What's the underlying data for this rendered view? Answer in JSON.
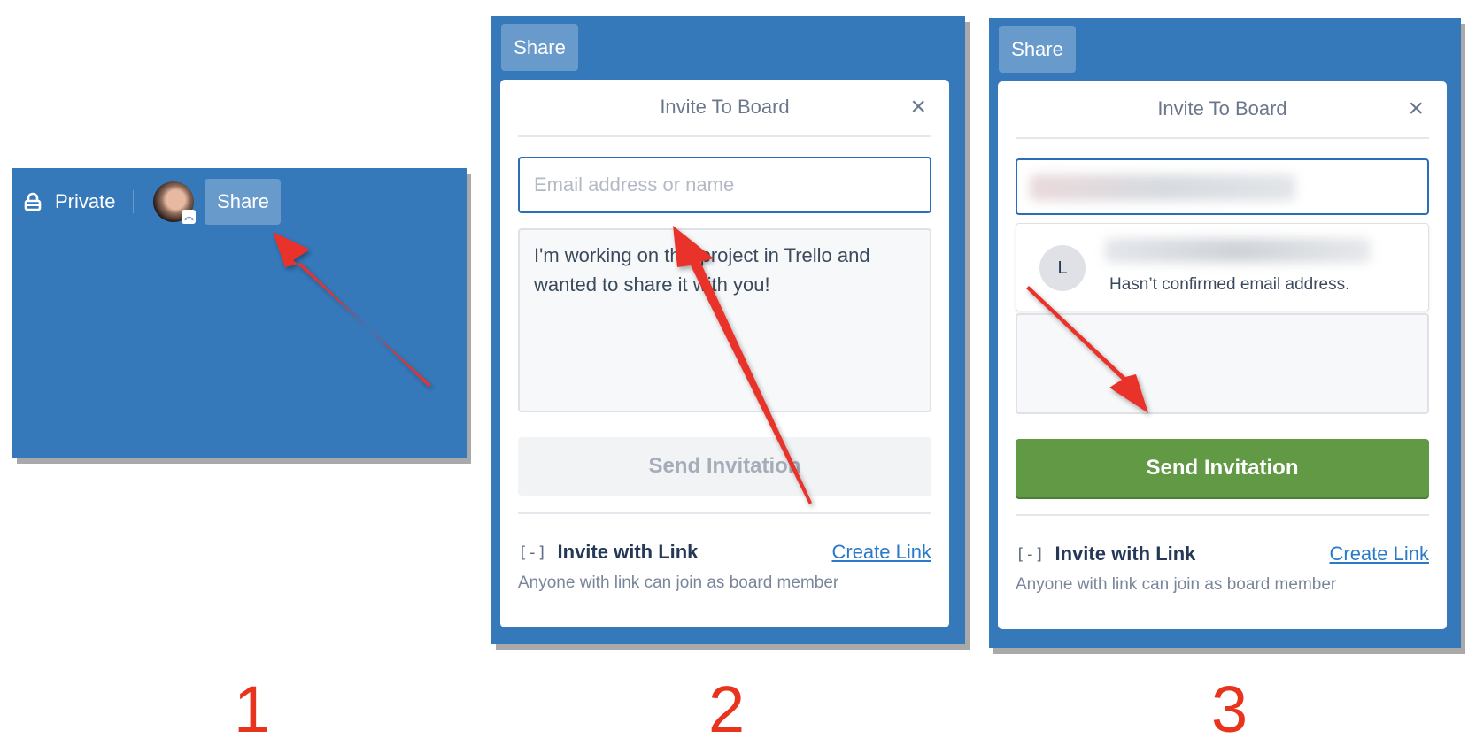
{
  "panel1": {
    "visibility_label": "Private",
    "share_label": "Share",
    "icons": {
      "lock": "lock-icon",
      "avatar": "member-avatar",
      "badge": "admin-chevrons-icon"
    }
  },
  "panel2": {
    "share_label": "Share",
    "dialog_title": "Invite To Board",
    "close_label": "×",
    "email_placeholder": "Email address or name",
    "email_value": "",
    "message_text": "I'm working on this project in Trello and wanted to share it with you!",
    "send_label": "Send Invitation",
    "send_state": "disabled",
    "invite_link_label": "Invite with Link",
    "invite_link_icon": "[-]",
    "create_link_label": "Create Link",
    "link_description": "Anyone with link can join as board member"
  },
  "panel3": {
    "share_label": "Share",
    "dialog_title": "Invite To Board",
    "close_label": "×",
    "email_value_redacted": true,
    "suggestion": {
      "initial": "L",
      "name_redacted": true,
      "note": "Hasn’t confirmed email address."
    },
    "send_label": "Send Invitation",
    "send_state": "enabled",
    "invite_link_label": "Invite with Link",
    "invite_link_icon": "[-]",
    "create_link_label": "Create Link",
    "link_description": "Anyone with link can join as board member"
  },
  "steps": [
    "1",
    "2",
    "3"
  ],
  "colors": {
    "board_blue": "#3679bb",
    "send_green": "#629945",
    "link_blue": "#2a7ac7",
    "annotation_red": "#e8341c"
  }
}
